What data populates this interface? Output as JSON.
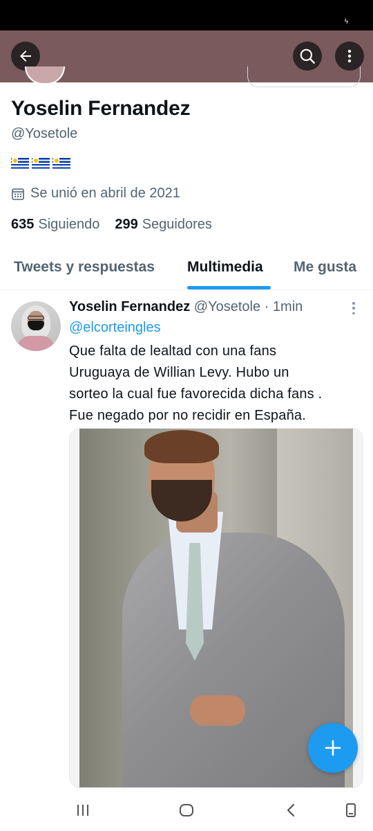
{
  "status_bar": {
    "charge_glyph": "ϟ"
  },
  "header": {
    "back_icon": "arrow-left-icon",
    "search_icon": "search-icon",
    "more_icon": "more-vertical-icon",
    "background_color": "#7a5a5c"
  },
  "profile": {
    "name": "Yoselin Fernandez",
    "handle": "@Yosetole",
    "bio_flags": [
      "flag-uruguay-icon",
      "flag-uruguay-icon",
      "flag-uruguay-icon"
    ],
    "joined": "Se unió en abril de 2021",
    "following_count": "635",
    "following_label": "Siguiendo",
    "followers_count": "299",
    "followers_label": "Seguidores"
  },
  "tabs": [
    {
      "label": "Tweets y respuestas",
      "active": false
    },
    {
      "label": "Multimedia",
      "active": true
    },
    {
      "label": "Me gusta",
      "active": false
    }
  ],
  "tweet": {
    "author": "Yoselin Fernandez",
    "handle": "@Yosetole",
    "separator": "·",
    "time": "1min",
    "mention": "@elcorteingles",
    "text": "Que falta de lealtad con una fans\nUruguaya de Willian Levy. Hubo un\nsorteo la cual fue favorecida dicha fans .\nFue negado por no recidir en España."
  },
  "colors": {
    "accent": "#1d9bf0",
    "secondary_text": "#536471",
    "primary_text": "#0f1419"
  },
  "fab": {
    "icon": "plus-icon"
  },
  "nav": {
    "icons": [
      "recent-apps-icon",
      "home-icon",
      "back-icon",
      "rotate-icon"
    ]
  }
}
